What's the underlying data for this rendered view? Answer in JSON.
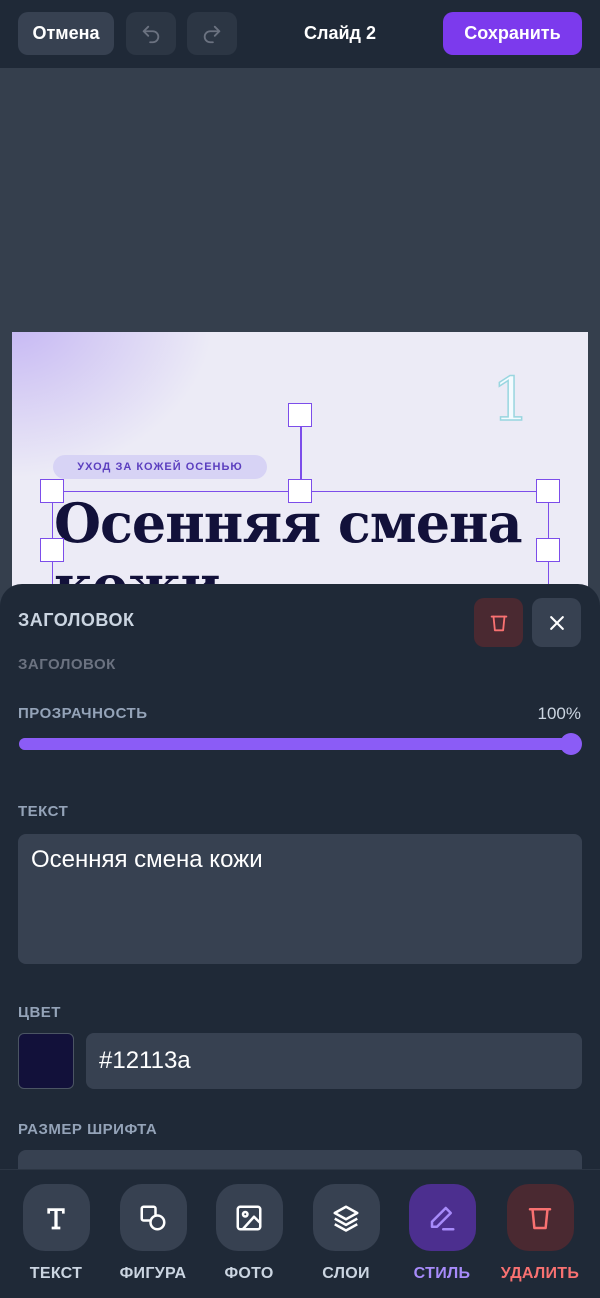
{
  "topbar": {
    "cancel_label": "Отмена",
    "title": "Слайд 2",
    "save_label": "Сохранить",
    "undo_icon": "undo-icon",
    "redo_icon": "redo-icon"
  },
  "slide": {
    "number": "1",
    "tag": "УХОД ЗА КОЖЕЙ ОСЕНЬЮ",
    "headline": "Осенняя смена кожи"
  },
  "sheet": {
    "title": "ЗАГОЛОВОК",
    "subtitle": "ЗАГОЛОВОК",
    "opacity_label": "ПРОЗРАЧНОСТЬ",
    "opacity_display": "100%",
    "opacity_fraction": 1.0,
    "text_label": "ТЕКСТ",
    "text_value": "Осенняя смена кожи",
    "color_label": "ЦВЕТ",
    "color_value": "#12113a",
    "font_size_label": "РАЗМЕР ШРИФТА"
  },
  "colors": {
    "accent": "#7c3aed",
    "slider": "#8b5cf6",
    "danger": "#f87171",
    "headline": "#12113a"
  },
  "toolbar": {
    "items": [
      {
        "label": "ТЕКСТ",
        "icon": "text-icon"
      },
      {
        "label": "ФИГУРА",
        "icon": "shape-icon"
      },
      {
        "label": "ФОТО",
        "icon": "image-icon"
      },
      {
        "label": "СЛОИ",
        "icon": "layers-icon"
      },
      {
        "label": "СТИЛЬ",
        "icon": "pen-icon"
      },
      {
        "label": "УДАЛИТЬ",
        "icon": "trash-icon"
      }
    ]
  }
}
